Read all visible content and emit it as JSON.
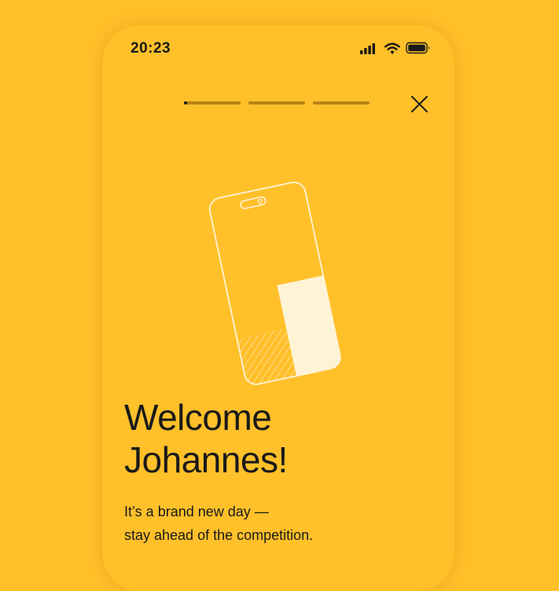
{
  "status_bar": {
    "time": "20:23",
    "icons": [
      "cellular-signal-icon",
      "wifi-icon",
      "battery-icon"
    ]
  },
  "onboarding": {
    "progress": {
      "total_steps": 3,
      "current_step": 1,
      "current_step_fraction": 0.05
    },
    "close_icon": "close-icon",
    "illustration_icon": "phone-illustration-icon",
    "title_lines": [
      "Welcome",
      "Johannes!"
    ],
    "subtitle_lines": [
      "It’s a brand new day —",
      "stay ahead of the competition."
    ]
  },
  "colors": {
    "background": "#FFC02A",
    "text": "#1A1A1A",
    "progress_track": "#B88417",
    "illustration_fill": "#FFF3D6"
  }
}
